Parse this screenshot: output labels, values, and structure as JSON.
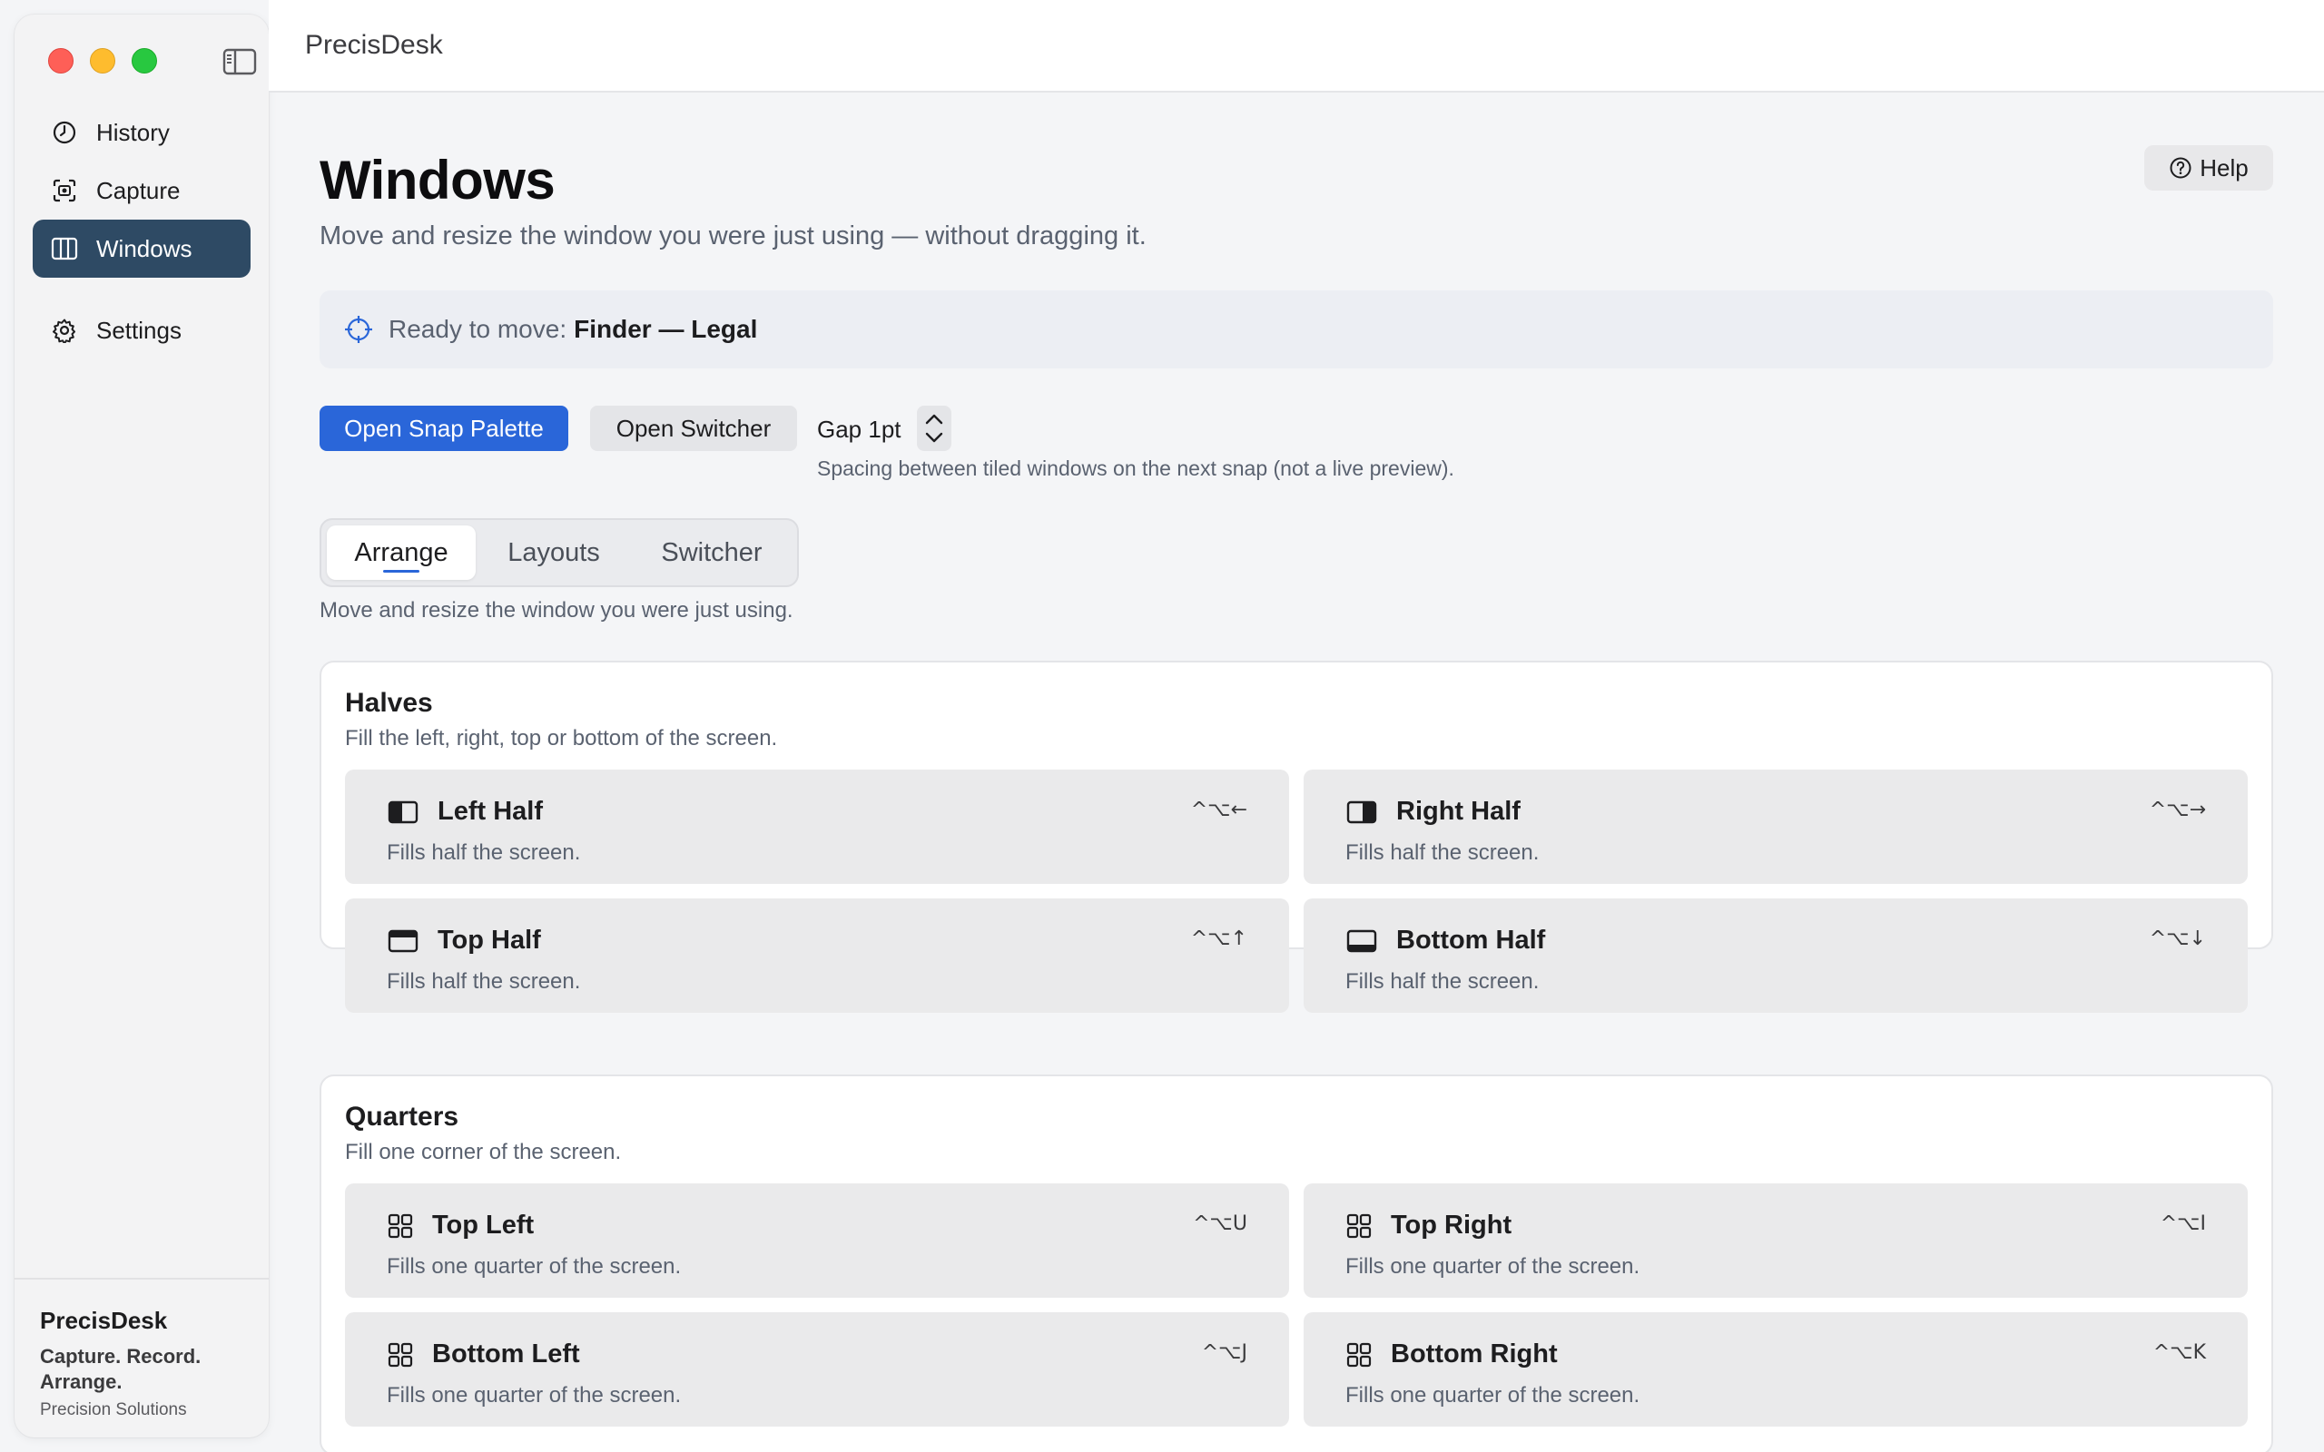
{
  "app": {
    "title": "PrecisDesk"
  },
  "sidebar": {
    "items": [
      {
        "label": "History",
        "icon": "clock-icon"
      },
      {
        "label": "Capture",
        "icon": "camera-capture-icon"
      },
      {
        "label": "Windows",
        "icon": "columns-icon",
        "active": true
      },
      {
        "label": "Settings",
        "icon": "gear-icon"
      }
    ],
    "footer": {
      "name": "PrecisDesk",
      "tagline": "Capture. Record. Arrange.",
      "company": "Precision Solutions"
    }
  },
  "page": {
    "title": "Windows",
    "subtitle": "Move and resize the window you were just using — without dragging it.",
    "help_label": "Help"
  },
  "ready": {
    "prefix": "Ready to move:",
    "target": "Finder — Legal"
  },
  "actions": {
    "primary_label": "Open Snap Palette",
    "secondary_label": "Open Switcher",
    "gap_label": "Gap 1pt",
    "gap_hint": "Spacing between tiled windows on the next snap (not a live preview)."
  },
  "tabs": {
    "items": [
      "Arrange",
      "Layouts",
      "Switcher"
    ],
    "active": "Arrange",
    "hint": "Move and resize the window you were just using."
  },
  "halves": {
    "title": "Halves",
    "subtitle": "Fill the left, right, top or bottom of the screen.",
    "cards": [
      {
        "title": "Left Half",
        "sub": "Fills half the screen.",
        "shortcut": "^⌥←",
        "icon": "left-half-icon"
      },
      {
        "title": "Right Half",
        "sub": "Fills half the screen.",
        "shortcut": "^⌥→",
        "icon": "right-half-icon"
      },
      {
        "title": "Top Half",
        "sub": "Fills half the screen.",
        "shortcut": "^⌥↑",
        "icon": "top-half-icon"
      },
      {
        "title": "Bottom Half",
        "sub": "Fills half the screen.",
        "shortcut": "^⌥↓",
        "icon": "bottom-half-icon"
      }
    ]
  },
  "quarters": {
    "title": "Quarters",
    "subtitle": "Fill one corner of the screen.",
    "cards": [
      {
        "title": "Top Left",
        "sub": "Fills one quarter of the screen.",
        "shortcut": "^⌥U",
        "icon": "grid-icon"
      },
      {
        "title": "Top Right",
        "sub": "Fills one quarter of the screen.",
        "shortcut": "^⌥I",
        "icon": "grid-icon"
      },
      {
        "title": "Bottom Left",
        "sub": "Fills one quarter of the screen.",
        "shortcut": "^⌥J",
        "icon": "grid-icon"
      },
      {
        "title": "Bottom Right",
        "sub": "Fills one quarter of the screen.",
        "shortcut": "^⌥K",
        "icon": "grid-icon"
      }
    ]
  },
  "colors": {
    "accent": "#2a66d9",
    "sidebar_active": "#2e4a64",
    "traffic_red": "#fe5f57",
    "traffic_yellow": "#febc2e",
    "traffic_green": "#28c840"
  }
}
